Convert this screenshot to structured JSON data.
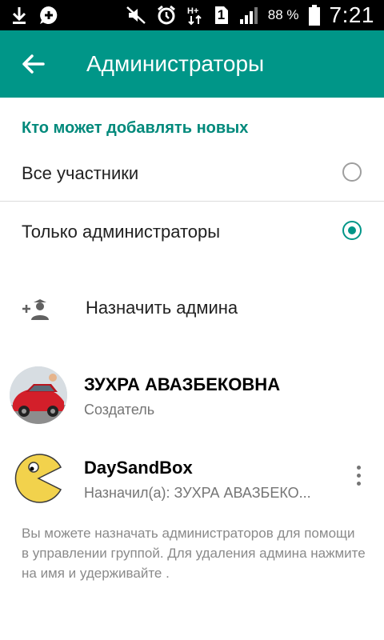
{
  "status_bar": {
    "battery_percent": "88 %",
    "time": "7:21",
    "sim_number": "1",
    "icons": [
      "download-icon",
      "chat-notification-icon",
      "mute-icon",
      "alarm-icon",
      "data-transfer-icon",
      "sim-icon",
      "signal-icon",
      "battery-icon"
    ]
  },
  "toolbar": {
    "title": "Администраторы",
    "back_icon": "arrow-back-icon"
  },
  "section": {
    "title": "Кто может добавлять новых"
  },
  "options": [
    {
      "label": "Все участники",
      "selected": false
    },
    {
      "label": "Только администраторы",
      "selected": true
    }
  ],
  "assign": {
    "label": "Назначить админа",
    "icon": "add-admin-icon"
  },
  "members": [
    {
      "name": "ЗУХРА АВАЗБЕКОВНА",
      "subtitle": "Создатель",
      "avatar": "car-photo"
    },
    {
      "name": "DaySandBox",
      "subtitle": "Назначил(а): ЗУХРА АВАЗБЕКО...",
      "avatar": "pacman-face",
      "has_menu": true
    }
  ],
  "footer": {
    "note": "Вы можете назначать администраторов для помощи в управлении группой. Для удаления админа нажмите на имя и удерживайте ."
  },
  "colors": {
    "accent": "#009688",
    "status_bar": "#000000"
  }
}
